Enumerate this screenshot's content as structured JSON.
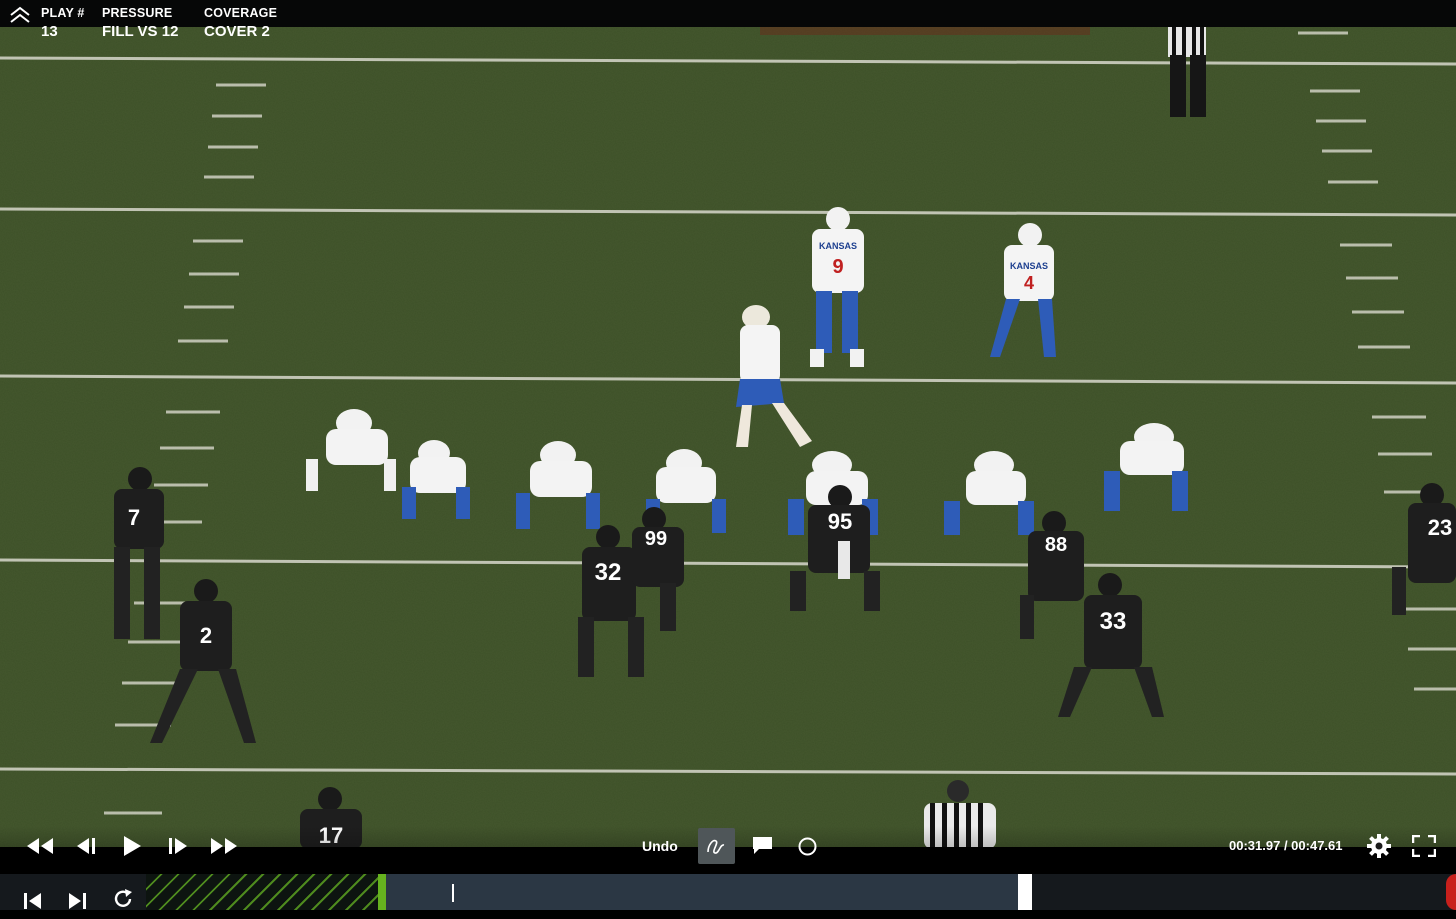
{
  "header": {
    "play_label": "PLAY #",
    "play_value": "13",
    "pressure_label": "PRESSURE",
    "pressure_value": "FILL VS 12",
    "coverage_label": "COVERAGE",
    "coverage_value": "COVER 2"
  },
  "video": {
    "offense_wordmark": "KANSAS",
    "offense_numbers": [
      "9",
      "4"
    ],
    "defense_numbers": [
      "7",
      "2",
      "32",
      "99",
      "95",
      "88",
      "33",
      "23",
      "17"
    ]
  },
  "controls": {
    "undo_label": "Undo",
    "time_current": "00:31.97",
    "time_separator": " / ",
    "time_total": "00:47.61"
  },
  "timeline": {
    "played_fraction": 0.27,
    "playhead_fraction": 0.35
  },
  "colors": {
    "played_accent": "#66b21f",
    "track": "#2b3744",
    "marker": "#c8201c",
    "field": "#3d5028"
  },
  "icons": [
    "collapse-chevron-icon",
    "fast-rewind-icon",
    "step-back-icon",
    "play-icon",
    "step-forward-icon",
    "fast-forward-icon",
    "draw-pen-icon",
    "comment-icon",
    "circle-tool-icon",
    "settings-gear-icon",
    "fullscreen-icon",
    "skip-start-icon",
    "skip-end-icon",
    "replay-icon"
  ]
}
